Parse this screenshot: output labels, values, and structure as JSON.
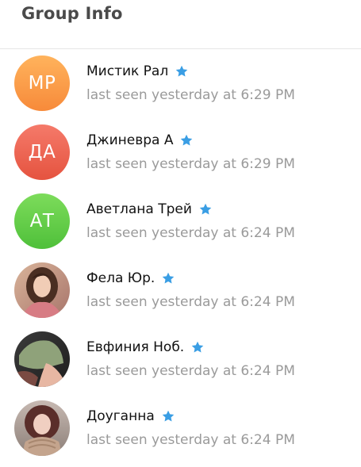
{
  "header": {
    "title": "Group Info"
  },
  "members": [
    {
      "name": "Мистик Рал",
      "status": "last seen yesterday at 6:29 PM",
      "initials": "МР",
      "avatar_type": "initials",
      "avatar_gradient": [
        "#ffb35c",
        "#f78a3a"
      ],
      "star_icon": "star-icon"
    },
    {
      "name": "Джиневра А",
      "status": "last seen yesterday at 6:29 PM",
      "initials": "ДА",
      "avatar_type": "initials",
      "avatar_gradient": [
        "#f57a6a",
        "#e5533f"
      ],
      "star_icon": "star-icon"
    },
    {
      "name": "Аветлана Трей",
      "status": "last seen yesterday at 6:24 PM",
      "initials": "АТ",
      "avatar_type": "initials",
      "avatar_gradient": [
        "#7ddc5b",
        "#4fc03a"
      ],
      "star_icon": "star-icon"
    },
    {
      "name": "Фела Юр.",
      "status": "last seen yesterday at 6:24 PM",
      "avatar_type": "photo",
      "photo_icon": "profile-photo-1",
      "star_icon": "star-icon"
    },
    {
      "name": "Евфиния Ноб.",
      "status": "last seen yesterday at 6:24 PM",
      "avatar_type": "photo",
      "photo_icon": "profile-photo-2",
      "star_icon": "star-icon"
    },
    {
      "name": "Доуганна",
      "status": "last seen yesterday at 6:24 PM",
      "avatar_type": "photo",
      "photo_icon": "profile-photo-3",
      "star_icon": "star-icon"
    }
  ],
  "colors": {
    "star": "#3a9ee4",
    "status_text": "#9a9a9a",
    "name_text": "#111111",
    "header_text": "#4a4a4a",
    "divider": "#e6e6e6"
  }
}
